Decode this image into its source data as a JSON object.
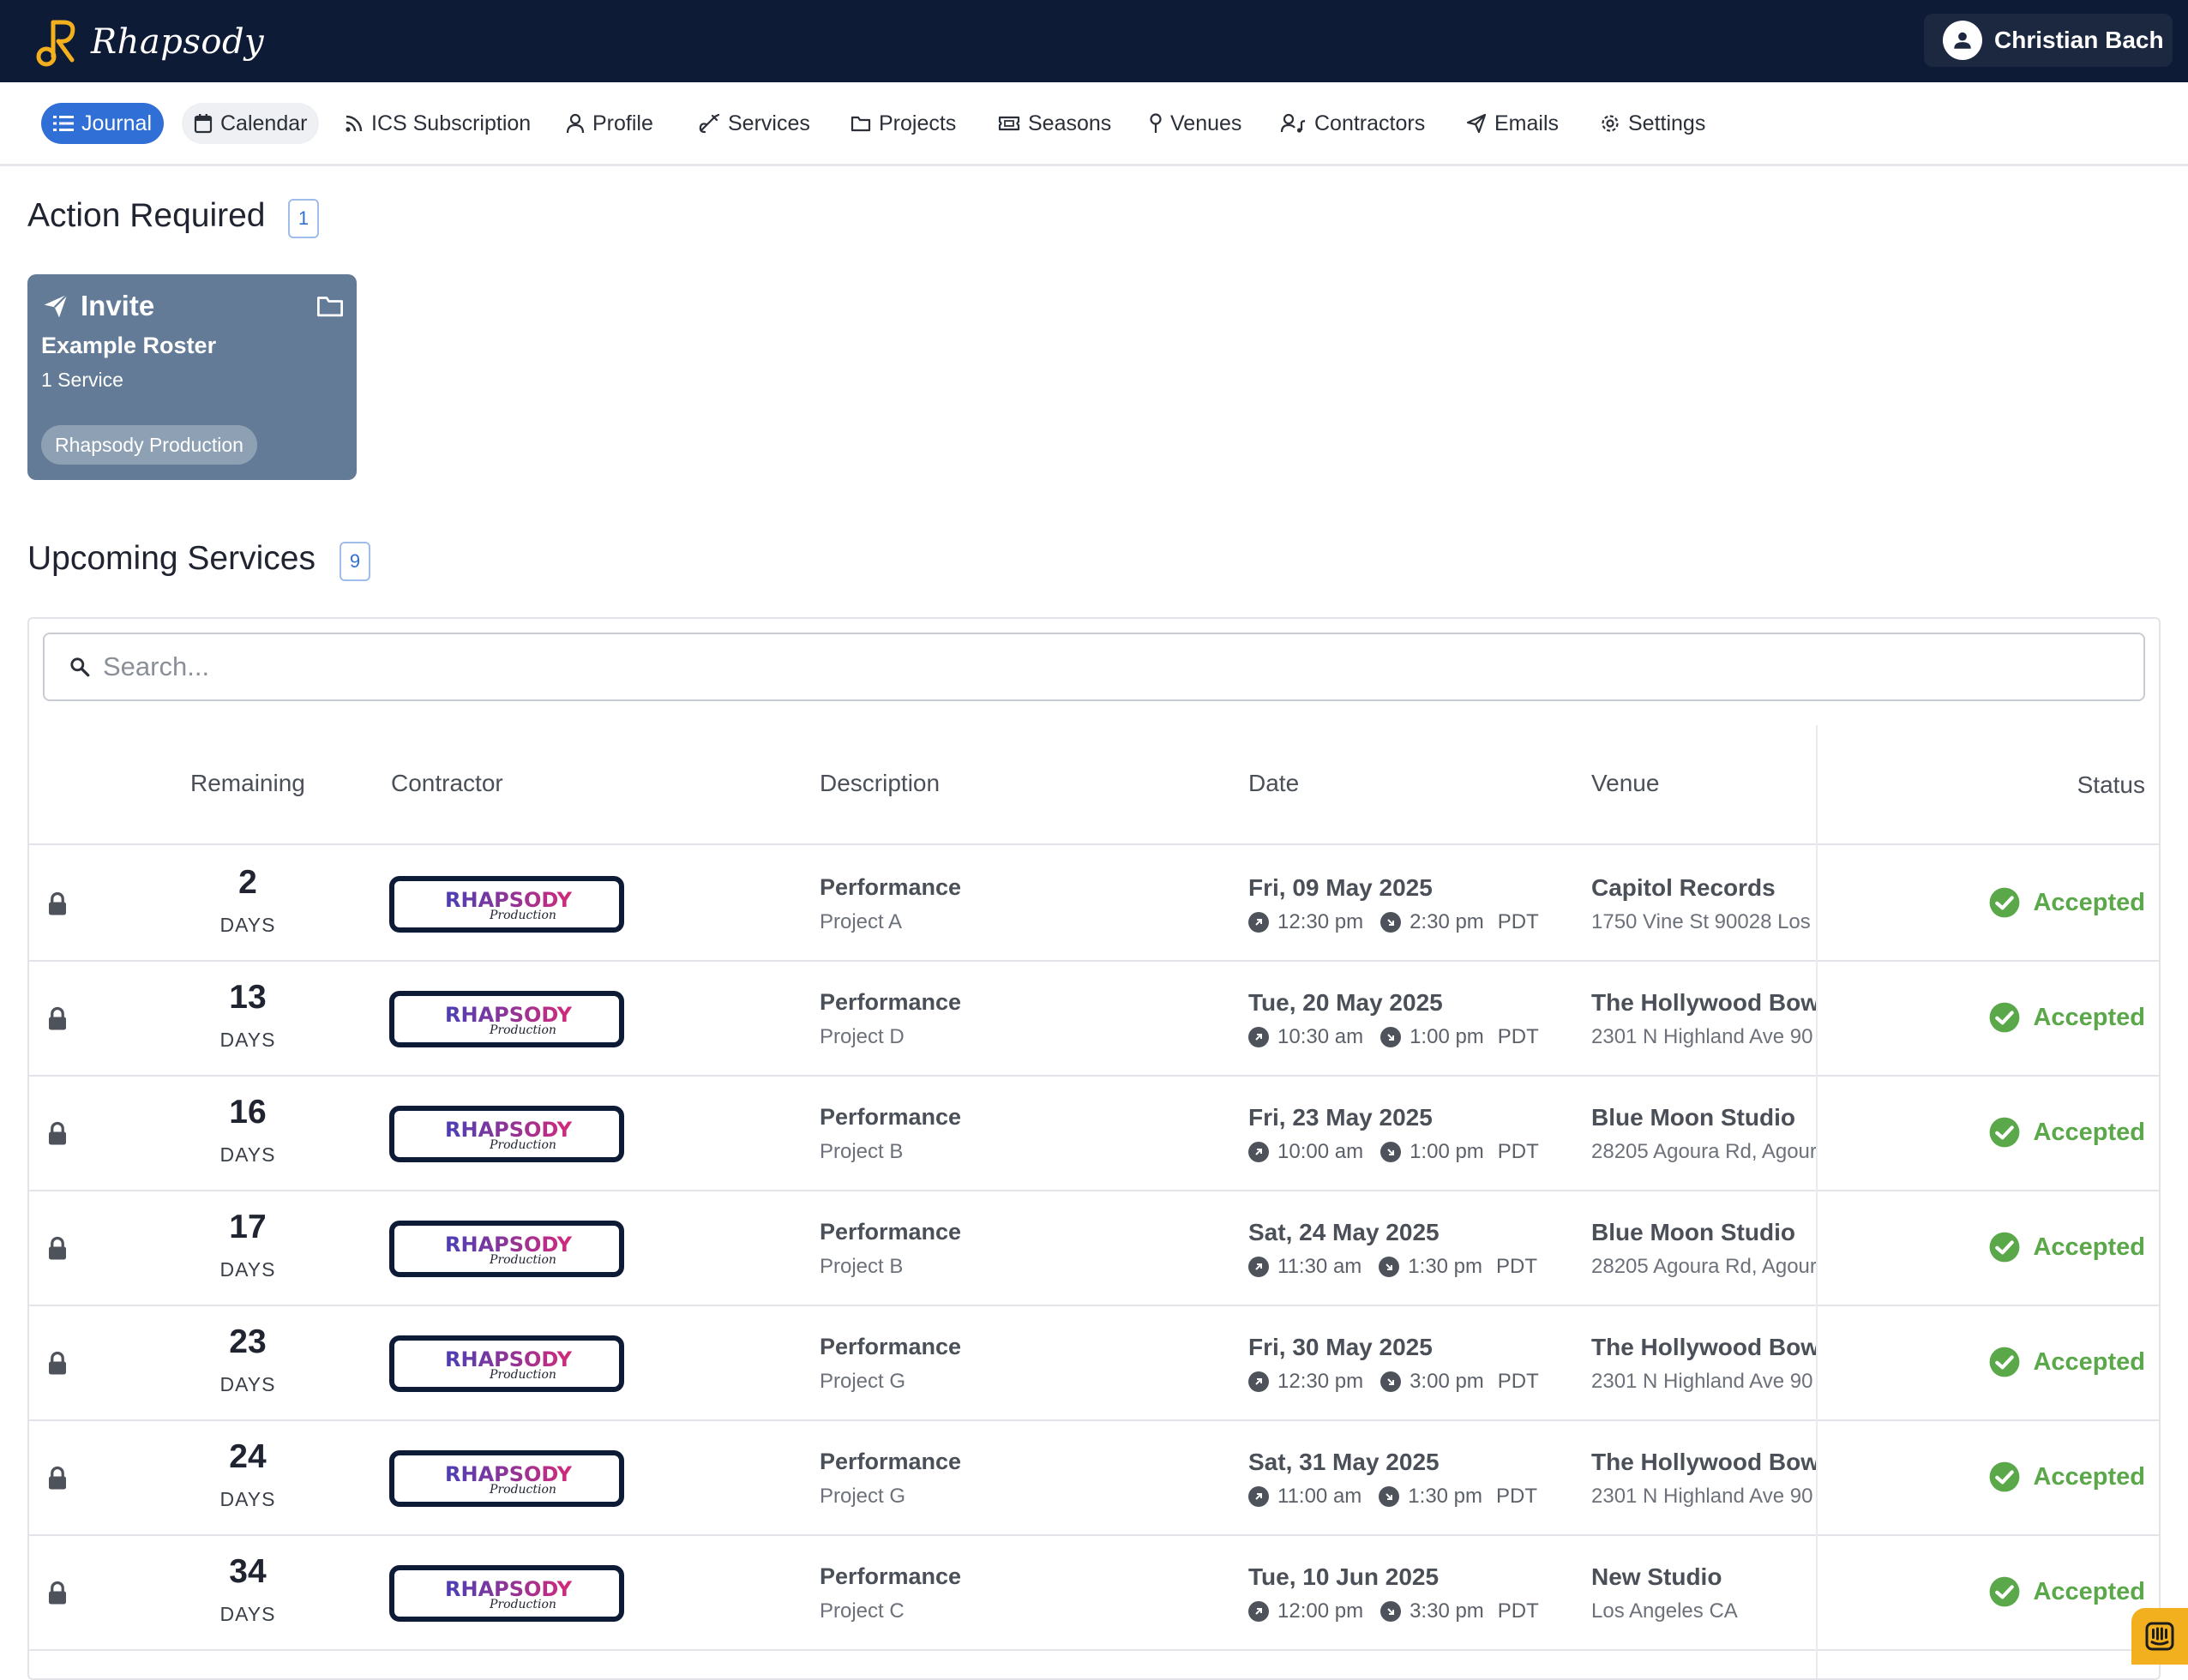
{
  "app": {
    "name": "Rhapsody"
  },
  "user": {
    "name": "Christian Bach"
  },
  "nav": [
    {
      "label": "Journal",
      "icon": "list-icon"
    },
    {
      "label": "Calendar",
      "icon": "calendar-icon"
    },
    {
      "label": "ICS Subscription",
      "icon": "rss-icon"
    },
    {
      "label": "Profile",
      "icon": "user-icon"
    },
    {
      "label": "Services",
      "icon": "instrument-icon"
    },
    {
      "label": "Projects",
      "icon": "folder-icon"
    },
    {
      "label": "Seasons",
      "icon": "ticket-icon"
    },
    {
      "label": "Venues",
      "icon": "map-pin-icon"
    },
    {
      "label": "Contractors",
      "icon": "user-music-icon"
    },
    {
      "label": "Emails",
      "icon": "send-icon"
    },
    {
      "label": "Settings",
      "icon": "gear-icon"
    }
  ],
  "action_required": {
    "title": "Action Required",
    "count": "1",
    "card": {
      "type": "Invite",
      "title": "Example Roster",
      "subtitle": "1 Service",
      "chip": "Rhapsody Production"
    }
  },
  "upcoming": {
    "title": "Upcoming Services",
    "count": "9",
    "search_placeholder": "Search...",
    "columns": {
      "remaining": "Remaining",
      "contractor": "Contractor",
      "description": "Description",
      "date": "Date",
      "venue": "Venue",
      "status": "Status"
    },
    "contractor_logo": {
      "line1": "RHAPSODY",
      "line2": "Production"
    },
    "rows": [
      {
        "days": "2",
        "unit": "DAYS",
        "desc": "Performance",
        "project": "Project A",
        "date": "Fri, 09 May 2025",
        "start": "12:30 pm",
        "end": "2:30 pm",
        "tz": "PDT",
        "venue": "Capitol Records",
        "address": "1750 Vine St 90028 Los",
        "status": "Accepted"
      },
      {
        "days": "13",
        "unit": "DAYS",
        "desc": "Performance",
        "project": "Project D",
        "date": "Tue, 20 May 2025",
        "start": "10:30 am",
        "end": "1:00 pm",
        "tz": "PDT",
        "venue": "The Hollywood Bowl",
        "address": "2301 N Highland Ave 90",
        "status": "Accepted"
      },
      {
        "days": "16",
        "unit": "DAYS",
        "desc": "Performance",
        "project": "Project B",
        "date": "Fri, 23 May 2025",
        "start": "10:00 am",
        "end": "1:00 pm",
        "tz": "PDT",
        "venue": "Blue Moon Studio",
        "address": "28205 Agoura Rd, Agour",
        "status": "Accepted"
      },
      {
        "days": "17",
        "unit": "DAYS",
        "desc": "Performance",
        "project": "Project B",
        "date": "Sat, 24 May 2025",
        "start": "11:30 am",
        "end": "1:30 pm",
        "tz": "PDT",
        "venue": "Blue Moon Studio",
        "address": "28205 Agoura Rd, Agour",
        "status": "Accepted"
      },
      {
        "days": "23",
        "unit": "DAYS",
        "desc": "Performance",
        "project": "Project G",
        "date": "Fri, 30 May 2025",
        "start": "12:30 pm",
        "end": "3:00 pm",
        "tz": "PDT",
        "venue": "The Hollywood Bowl",
        "address": "2301 N Highland Ave 90",
        "status": "Accepted"
      },
      {
        "days": "24",
        "unit": "DAYS",
        "desc": "Performance",
        "project": "Project G",
        "date": "Sat, 31 May 2025",
        "start": "11:00 am",
        "end": "1:30 pm",
        "tz": "PDT",
        "venue": "The Hollywood Bowl",
        "address": "2301 N Highland Ave 90",
        "status": "Accepted"
      },
      {
        "days": "34",
        "unit": "DAYS",
        "desc": "Performance",
        "project": "Project C",
        "date": "Tue, 10 Jun 2025",
        "start": "12:00 pm",
        "end": "3:30 pm",
        "tz": "PDT",
        "venue": "New Studio",
        "address": "Los Angeles CA",
        "status": "Accepted"
      }
    ]
  },
  "colors": {
    "header_bg": "#0e1b37",
    "accent": "#2f6fd6",
    "card_bg": "#637b96",
    "status_accepted": "#5aa84a",
    "logo_gold": "#f2b01e"
  }
}
